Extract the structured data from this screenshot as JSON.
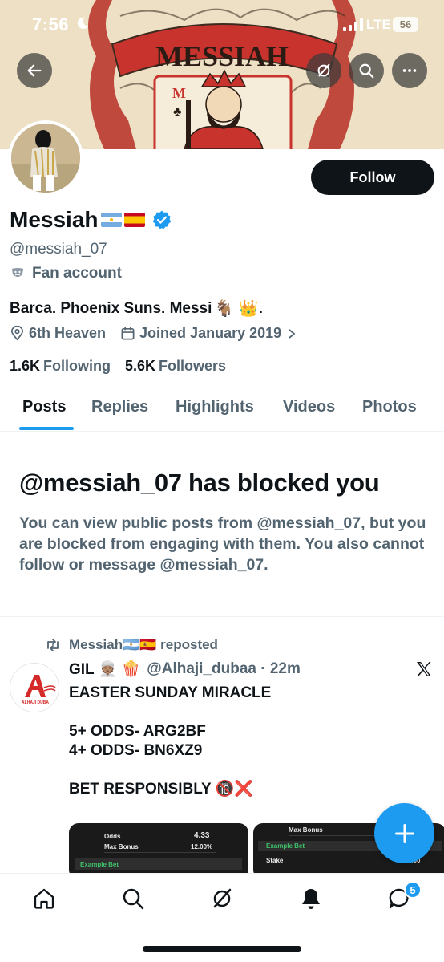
{
  "status_bar": {
    "time": "7:56",
    "network": "LTE",
    "battery": "56"
  },
  "banner": {
    "text": "MESSIAH",
    "card_letter": "M"
  },
  "header_buttons": [
    "back-icon",
    "grok-icon",
    "search-icon",
    "more-icon"
  ],
  "profile": {
    "display_name": "Messiah",
    "handle": "@messiah_07",
    "label": "Fan account",
    "bio": "Barca. Phoenix Suns. Messi",
    "bio_emojis": "🐐 👑",
    "bio_end": ".",
    "location": "6th Heaven",
    "joined": "Joined January 2019",
    "following_count": "1.6K",
    "following_label": "Following",
    "followers_count": "5.6K",
    "followers_label": "Followers",
    "follow_button": "Follow"
  },
  "tabs": [
    "Posts",
    "Replies",
    "Highlights",
    "Videos",
    "Photos"
  ],
  "blocked": {
    "title": "@messiah_07 has blocked you",
    "text": "You can view public posts from @messiah_07, but you are blocked from engaging with them. You also cannot follow or message @messiah_07."
  },
  "post": {
    "repost_label": "Messiah🇦🇷🇪🇸 reposted",
    "author": "GIL 👳🏽 🍿",
    "handle_time": "@Alhaji_dubaa · 22m",
    "avatar_text": "ALHAJI DUBA",
    "lines": [
      "EASTER SUNDAY MIRACLE",
      "",
      "5+ ODDS- ARG2BF",
      "4+ ODDS- BN6XZ9",
      "",
      "BET RESPONSIBLY 🔞❌"
    ],
    "media1": {
      "odds_label": "Odds",
      "odds_value": "4.33",
      "bonus_label": "Max Bonus",
      "bonus_value": "12.00%",
      "example": "Example Bet"
    },
    "media2": {
      "bonus_label": "Max Bonus",
      "example": "Example Bet",
      "stake_label": "Stake",
      "stake_value": "100.00"
    }
  },
  "bottom_nav": [
    "home-icon",
    "search-icon",
    "grok-icon",
    "notifications-icon",
    "messages-icon"
  ],
  "messages_badge": "5",
  "colors": {
    "accent": "#1d9bf0",
    "text": "#0f1419",
    "secondary": "#536471"
  }
}
